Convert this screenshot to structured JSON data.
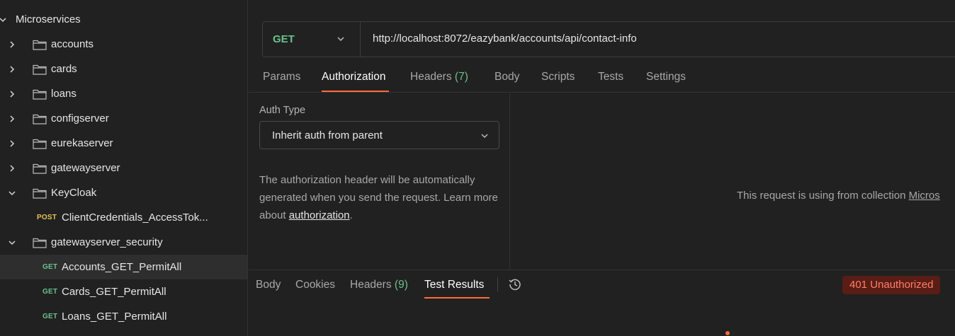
{
  "sidebar": {
    "root_label": "Microservices",
    "folders": [
      {
        "label": "accounts",
        "expanded": false
      },
      {
        "label": "cards",
        "expanded": false
      },
      {
        "label": "loans",
        "expanded": false
      },
      {
        "label": "configserver",
        "expanded": false
      },
      {
        "label": "eurekaserver",
        "expanded": false
      },
      {
        "label": "gatewayserver",
        "expanded": false
      },
      {
        "label": "KeyCloak",
        "expanded": true
      },
      {
        "label": "gatewayserver_security",
        "expanded": true
      }
    ],
    "keycloak_request": {
      "method": "POST",
      "label": "ClientCredentials_AccessTok..."
    },
    "security_requests": [
      {
        "method": "GET",
        "label": "Accounts_GET_PermitAll",
        "selected": true
      },
      {
        "method": "GET",
        "label": "Cards_GET_PermitAll",
        "selected": false
      },
      {
        "method": "GET",
        "label": "Loans_GET_PermitAll",
        "selected": false
      }
    ]
  },
  "request": {
    "method": "GET",
    "url": "http://localhost:8072/eazybank/accounts/api/contact-info",
    "tabs": [
      {
        "label": "Params"
      },
      {
        "label": "Authorization",
        "active": true
      },
      {
        "label": "Headers",
        "count": "(7)"
      },
      {
        "label": "Body"
      },
      {
        "label": "Scripts"
      },
      {
        "label": "Tests"
      },
      {
        "label": "Settings"
      }
    ]
  },
  "auth": {
    "type_label": "Auth Type",
    "type_value": "Inherit auth from parent",
    "desc_prefix": "The authorization header will be automatically generated when you send the request. Learn more about ",
    "desc_link": "authorization",
    "desc_suffix": ".",
    "right_text": "This request is using from collection ",
    "right_link": "Micros"
  },
  "response": {
    "tabs": [
      {
        "label": "Body"
      },
      {
        "label": "Cookies"
      },
      {
        "label": "Headers",
        "count": "(9)"
      },
      {
        "label": "Test Results",
        "active": true
      }
    ],
    "status": "401 Unauthorized"
  },
  "colors": {
    "accent": "#ff6c37",
    "get": "#6bc18f",
    "post": "#e5c158",
    "status_bg": "#5a1d15",
    "status_text": "#ff7f6a"
  },
  "icons": [
    "chevron-right-icon",
    "chevron-down-icon",
    "folder-icon",
    "history-icon",
    "check-icon"
  ]
}
